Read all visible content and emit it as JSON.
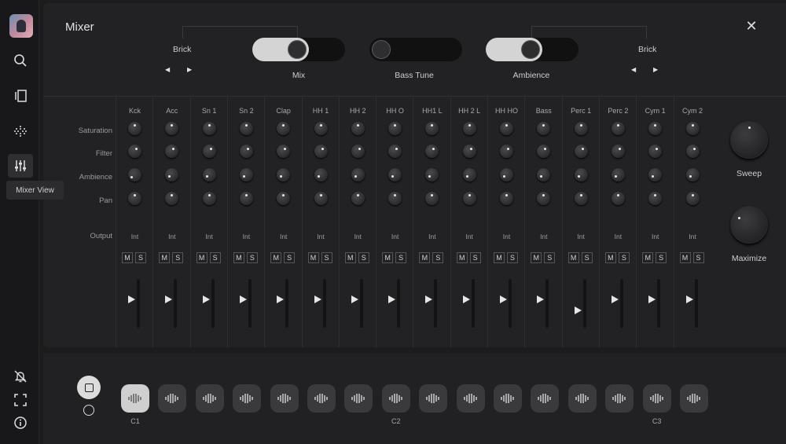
{
  "sidebar": {
    "items": [
      {
        "name": "search",
        "icon": "search-icon"
      },
      {
        "name": "library",
        "icon": "library-icon"
      },
      {
        "name": "sequencer",
        "icon": "dots-grid-icon"
      },
      {
        "name": "mixer",
        "icon": "sliders-icon"
      }
    ],
    "tooltip": "Mixer View",
    "bottom_items": [
      {
        "name": "notifications-off",
        "icon": "bell-off-icon"
      },
      {
        "name": "fullscreen",
        "icon": "fullscreen-icon"
      },
      {
        "name": "info",
        "icon": "info-icon"
      }
    ]
  },
  "mixer": {
    "title": "Mixer",
    "close": "✕",
    "left_preset": {
      "label": "Brick",
      "prev": "◀",
      "next": "▶"
    },
    "right_preset": {
      "label": "Brick",
      "prev": "◀",
      "next": "▶"
    },
    "toggles": [
      {
        "label": "Mix",
        "on": true
      },
      {
        "label": "Bass Tune",
        "on": false
      },
      {
        "label": "Ambience",
        "on": true
      }
    ],
    "row_labels": {
      "saturation": "Saturation",
      "filter": "Filter",
      "ambience": "Ambience",
      "pan": "Pan",
      "output": "Output"
    },
    "mute_label": "M",
    "solo_label": "S",
    "channels": [
      {
        "name": "Kck",
        "output": "Int",
        "fader": 0.3
      },
      {
        "name": "Acc",
        "output": "Int",
        "fader": 0.3
      },
      {
        "name": "Sn 1",
        "output": "Int",
        "fader": 0.3
      },
      {
        "name": "Sn 2",
        "output": "Int",
        "fader": 0.3
      },
      {
        "name": "Clap",
        "output": "Int",
        "fader": 0.3
      },
      {
        "name": "HH 1",
        "output": "Int",
        "fader": 0.3
      },
      {
        "name": "HH 2",
        "output": "Int",
        "fader": 0.3
      },
      {
        "name": "HH O",
        "output": "Int",
        "fader": 0.3
      },
      {
        "name": "HH1 L",
        "output": "Int",
        "fader": 0.3
      },
      {
        "name": "HH 2 L",
        "output": "Int",
        "fader": 0.3
      },
      {
        "name": "HH HO",
        "output": "Int",
        "fader": 0.3
      },
      {
        "name": "Bass",
        "output": "Int",
        "fader": 0.3
      },
      {
        "name": "Perc 1",
        "output": "Int",
        "fader": 0.08
      },
      {
        "name": "Perc 2",
        "output": "Int",
        "fader": 0.3
      },
      {
        "name": "Cym 1",
        "output": "Int",
        "fader": 0.3
      },
      {
        "name": "Cym 2",
        "output": "Int",
        "fader": 0.3
      }
    ],
    "master": [
      {
        "label": "Sweep"
      },
      {
        "label": "Maximize"
      }
    ]
  },
  "transport": {
    "stop_icon": "stop-icon",
    "record_icon": "record-icon",
    "pads": 16,
    "active_pad": 0,
    "pad_labels": [
      {
        "index": 0,
        "label": "C1"
      },
      {
        "index": 7,
        "label": "C2"
      },
      {
        "index": 14,
        "label": "C3"
      }
    ],
    "pad_icon": "waveform-icon"
  }
}
